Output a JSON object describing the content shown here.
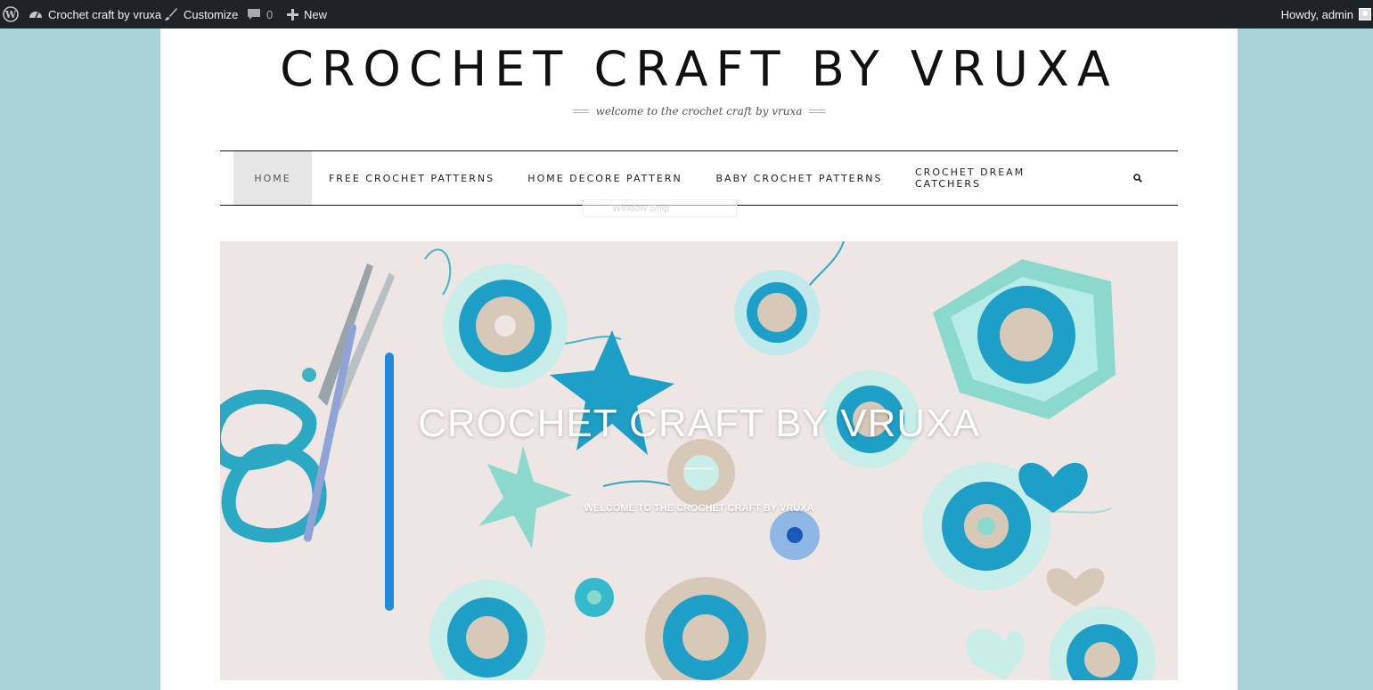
{
  "admin_bar": {
    "site_name": "Crochet craft by vruxa",
    "customize": "Customize",
    "comments_count": "0",
    "new": "New",
    "howdy": "Howdy, admin"
  },
  "header": {
    "site_title": "CROCHET CRAFT BY VRUXA",
    "tagline": "welcome to the crochet craft by vruxa"
  },
  "nav": {
    "items": [
      {
        "label": "HOME"
      },
      {
        "label": "FREE CROCHET PATTERNS"
      },
      {
        "label": "HOME DECORE PATTERN"
      },
      {
        "label": "BABY CROCHET PATTERNS"
      },
      {
        "label": "CROCHET DREAM CATCHERS"
      }
    ]
  },
  "ghost_tooltip": "Window Snip",
  "hero": {
    "title": "CROCHET CRAFT BY VRUXA",
    "subtitle": "WELCOME TO THE CROCHET CRAFT BY VRUXA"
  },
  "colors": {
    "page_background": "#a9d3d8",
    "admin_bar": "#1d2327",
    "accent_teal": "#1ea3c4"
  }
}
